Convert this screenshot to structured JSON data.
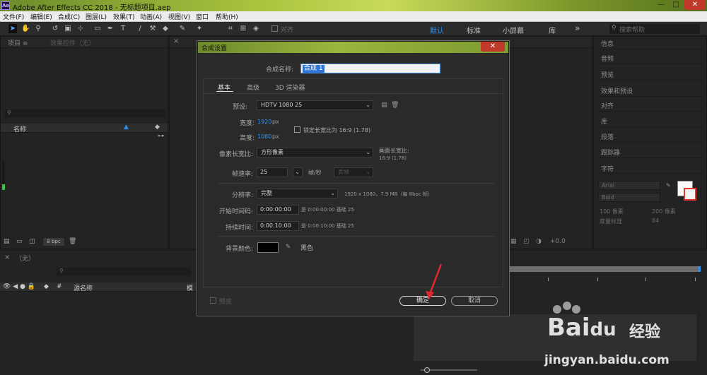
{
  "window": {
    "title": "Adobe After Effects CC 2018 - 无标题项目.aep",
    "logo_text": "Ae",
    "min_glyph": "—",
    "max_glyph": "□",
    "close_glyph": "✕"
  },
  "menu": [
    "文件(F)",
    "编辑(E)",
    "合成(C)",
    "图层(L)",
    "效果(T)",
    "动画(A)",
    "视图(V)",
    "窗口",
    "帮助(H)"
  ],
  "toolbar": {
    "align_label": "对齐",
    "workspaces": {
      "default": "默认",
      "standard": "标准",
      "small": "小屏幕",
      "library": "库",
      "more": "»"
    },
    "help_search_placeholder": "搜索帮助"
  },
  "project_panel": {
    "tab": "项目 ≡",
    "effects_tab": "效果控件（无）",
    "column_name": "名称",
    "bpc": "8 bpc"
  },
  "comp_panel": {
    "footer_value": "+0.0"
  },
  "right_panel": {
    "items": [
      "信息",
      "音频",
      "预览",
      "效果和预设",
      "对齐",
      "库",
      "段落",
      "跟踪器"
    ],
    "character_tab": "字符",
    "font": "Arial",
    "style": "Bold",
    "size": "100 像素",
    "leading": "200 像素",
    "kerning": "度量标准",
    "tracking": "84"
  },
  "timeline": {
    "tab": "（无）",
    "columns": {
      "source_name": "源名称",
      "mode": "模"
    }
  },
  "dialog": {
    "title": "合成设置",
    "name_label": "合成名称:",
    "name_value": "合成 1",
    "tabs": [
      "基本",
      "高级",
      "3D 渲染器"
    ],
    "preset_label": "预设:",
    "preset_value": "HDTV 1080 25",
    "width_label": "宽度:",
    "width_value": "1920",
    "height_label": "高度:",
    "height_value": "1080",
    "px": "px",
    "lock_ratio": "锁定长宽比为 16:9 (1.78)",
    "pixel_ratio_label": "像素长宽比:",
    "pixel_ratio_value": "方形像素",
    "frame_ratio_label": "画面长宽比:",
    "frame_ratio_value": "16:9 (1.78)",
    "fps_label": "帧速率:",
    "fps_value": "25",
    "fps_unit": "帧/秒",
    "drop_frame": "丢帧",
    "resolution_label": "分辨率:",
    "resolution_value": "完整",
    "resolution_info": "1920 x 1080，7.9 MB（每 8bpc 帧）",
    "start_label": "开始时间码:",
    "start_value": "0:00:00:00",
    "start_info": "是 0:00:00:00  基础 25",
    "duration_label": "持续时间:",
    "duration_value": "0:00:10:00",
    "duration_info": "是 0:00:10:00  基础 25",
    "bg_label": "背景颜色:",
    "bg_name": "黑色",
    "preview_label": "预览",
    "ok_label": "确定",
    "cancel_label": "取消"
  },
  "watermark": {
    "brand": "Bai",
    "brand2": "du",
    "brand_cn": "经验",
    "url": "jingyan.baidu.com"
  },
  "colors": {
    "accent_blue": "#2d8ceb",
    "annotation_red": "#e0282e"
  }
}
